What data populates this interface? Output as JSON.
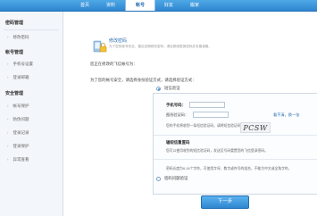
{
  "nav": {
    "tabs": [
      "首页",
      "资料",
      "帐号",
      "好友",
      "搬家"
    ]
  },
  "sidebar": {
    "section1": "密码管理",
    "item_change_password": "修改密码",
    "section2": "帐号管理",
    "item_phone": "手机号设置",
    "item_login_email": "登录邮箱",
    "section3": "安全管理",
    "item_account_protection": "帐号保护",
    "item_anti_theft": "防伪问题",
    "item_login_records": "登录记录",
    "item_login_protection": "登录保护",
    "item_abnormal": "异常查看"
  },
  "header": {
    "title": "修改密码",
    "description": "为了您的帐号安全，建议定期修改密码，请定期或更换密码并妥善保管。"
  },
  "notes": {
    "current_account": "您正在修改的飞信帐号为：",
    "verify_prompt": "为了您的帐号安全，请选择身份验证方式，请选择验证方式："
  },
  "options": {
    "sms": "短信验证",
    "question": "密码问题验证"
  },
  "panel": {
    "phone_label": "手机号码：",
    "captcha_label": "图形验证码：",
    "captcha_text": "PCSW",
    "refresh_label": "看不清，换一张",
    "sms_hint": "您的手机将收到一条短信验证码，请将短信验证码填写到下面。",
    "sms_code_title": "输短信重置码",
    "sms_code_hint": "您可以使用收到的短信验证码，发送至号码重置您的飞信登录密码。",
    "rule_hint": "密码长度为6-16个字符，可使用字母、数字或符号的组合，不能为中文或全角字符。"
  },
  "actions": {
    "next": "下一步"
  }
}
